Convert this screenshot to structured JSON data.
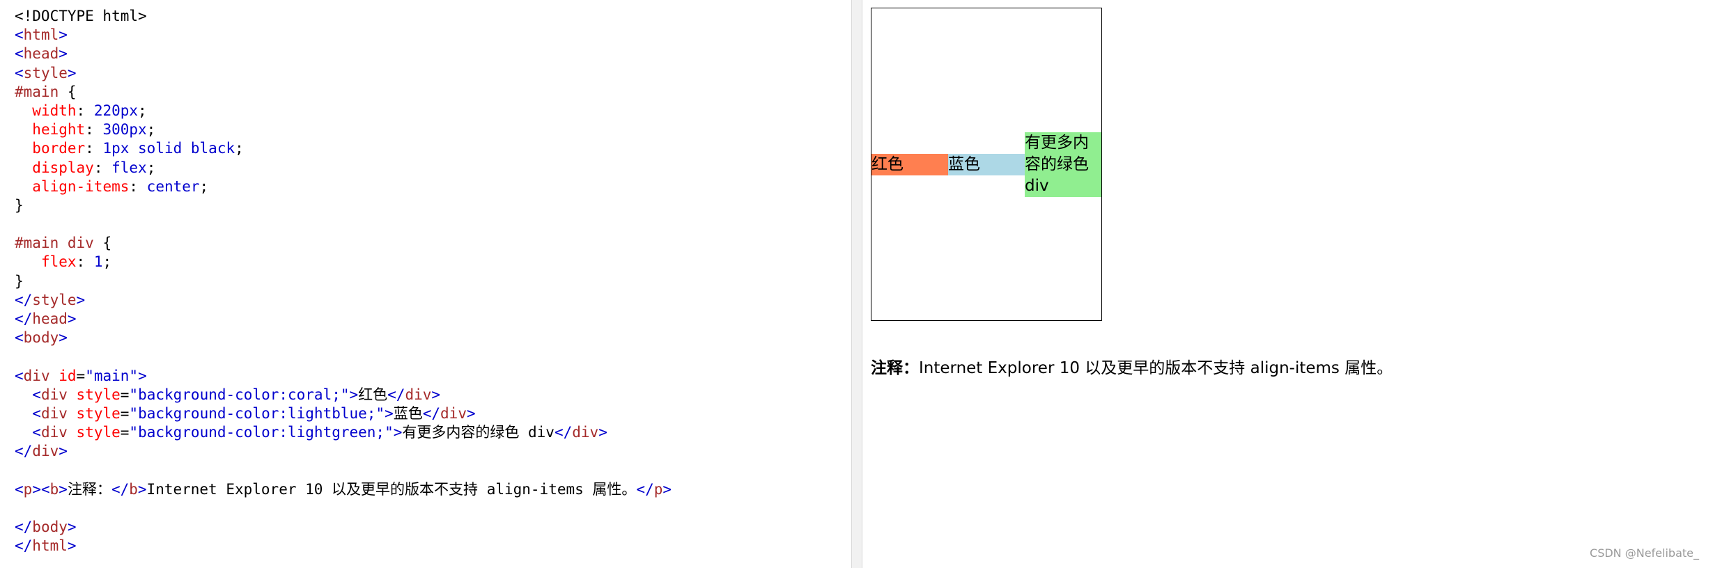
{
  "code_editor": {
    "lines": [
      [
        {
          "c": "plain",
          "t": "<!DOCTYPE html>"
        }
      ],
      [
        {
          "c": "tag",
          "t": "<"
        },
        {
          "c": "tn",
          "t": "html"
        },
        {
          "c": "tag",
          "t": ">"
        }
      ],
      [
        {
          "c": "tag",
          "t": "<"
        },
        {
          "c": "tn",
          "t": "head"
        },
        {
          "c": "tag",
          "t": ">"
        }
      ],
      [
        {
          "c": "tag",
          "t": "<"
        },
        {
          "c": "tn",
          "t": "style"
        },
        {
          "c": "tag",
          "t": ">"
        }
      ],
      [
        {
          "c": "sel",
          "t": "#main"
        },
        {
          "c": "plain",
          "t": " {"
        }
      ],
      [
        {
          "c": "plain",
          "t": "  "
        },
        {
          "c": "prop",
          "t": "width"
        },
        {
          "c": "plain",
          "t": ": "
        },
        {
          "c": "val",
          "t": "220px"
        },
        {
          "c": "plain",
          "t": ";"
        }
      ],
      [
        {
          "c": "plain",
          "t": "  "
        },
        {
          "c": "prop",
          "t": "height"
        },
        {
          "c": "plain",
          "t": ": "
        },
        {
          "c": "val",
          "t": "300px"
        },
        {
          "c": "plain",
          "t": ";"
        }
      ],
      [
        {
          "c": "plain",
          "t": "  "
        },
        {
          "c": "prop",
          "t": "border"
        },
        {
          "c": "plain",
          "t": ": "
        },
        {
          "c": "val",
          "t": "1px solid black"
        },
        {
          "c": "plain",
          "t": ";"
        }
      ],
      [
        {
          "c": "plain",
          "t": "  "
        },
        {
          "c": "prop",
          "t": "display"
        },
        {
          "c": "plain",
          "t": ": "
        },
        {
          "c": "val",
          "t": "flex"
        },
        {
          "c": "plain",
          "t": ";"
        }
      ],
      [
        {
          "c": "plain",
          "t": "  "
        },
        {
          "c": "prop",
          "t": "align-items"
        },
        {
          "c": "plain",
          "t": ": "
        },
        {
          "c": "val",
          "t": "center"
        },
        {
          "c": "plain",
          "t": ";"
        }
      ],
      [
        {
          "c": "plain",
          "t": "}"
        }
      ],
      [
        {
          "c": "plain",
          "t": ""
        }
      ],
      [
        {
          "c": "sel",
          "t": "#main div"
        },
        {
          "c": "plain",
          "t": " {"
        }
      ],
      [
        {
          "c": "plain",
          "t": "   "
        },
        {
          "c": "prop",
          "t": "flex"
        },
        {
          "c": "plain",
          "t": ": "
        },
        {
          "c": "val",
          "t": "1"
        },
        {
          "c": "plain",
          "t": ";"
        }
      ],
      [
        {
          "c": "plain",
          "t": "}"
        }
      ],
      [
        {
          "c": "tag",
          "t": "</"
        },
        {
          "c": "tn",
          "t": "style"
        },
        {
          "c": "tag",
          "t": ">"
        }
      ],
      [
        {
          "c": "tag",
          "t": "</"
        },
        {
          "c": "tn",
          "t": "head"
        },
        {
          "c": "tag",
          "t": ">"
        }
      ],
      [
        {
          "c": "tag",
          "t": "<"
        },
        {
          "c": "tn",
          "t": "body"
        },
        {
          "c": "tag",
          "t": ">"
        }
      ],
      [
        {
          "c": "plain",
          "t": ""
        }
      ],
      [
        {
          "c": "tag",
          "t": "<"
        },
        {
          "c": "tn",
          "t": "div"
        },
        {
          "c": "plain",
          "t": " "
        },
        {
          "c": "attr",
          "t": "id"
        },
        {
          "c": "plain",
          "t": "="
        },
        {
          "c": "aval",
          "t": "\"main\""
        },
        {
          "c": "tag",
          "t": ">"
        }
      ],
      [
        {
          "c": "plain",
          "t": "  "
        },
        {
          "c": "tag",
          "t": "<"
        },
        {
          "c": "tn",
          "t": "div"
        },
        {
          "c": "plain",
          "t": " "
        },
        {
          "c": "attr",
          "t": "style"
        },
        {
          "c": "plain",
          "t": "="
        },
        {
          "c": "aval",
          "t": "\"background-color:coral;\""
        },
        {
          "c": "tag",
          "t": ">"
        },
        {
          "c": "plain",
          "t": "红色"
        },
        {
          "c": "tag",
          "t": "</"
        },
        {
          "c": "tn",
          "t": "div"
        },
        {
          "c": "tag",
          "t": ">"
        }
      ],
      [
        {
          "c": "plain",
          "t": "  "
        },
        {
          "c": "tag",
          "t": "<"
        },
        {
          "c": "tn",
          "t": "div"
        },
        {
          "c": "plain",
          "t": " "
        },
        {
          "c": "attr",
          "t": "style"
        },
        {
          "c": "plain",
          "t": "="
        },
        {
          "c": "aval",
          "t": "\"background-color:lightblue;\""
        },
        {
          "c": "tag",
          "t": ">"
        },
        {
          "c": "plain",
          "t": "蓝色"
        },
        {
          "c": "tag",
          "t": "</"
        },
        {
          "c": "tn",
          "t": "div"
        },
        {
          "c": "tag",
          "t": ">"
        }
      ],
      [
        {
          "c": "plain",
          "t": "  "
        },
        {
          "c": "tag",
          "t": "<"
        },
        {
          "c": "tn",
          "t": "div"
        },
        {
          "c": "plain",
          "t": " "
        },
        {
          "c": "attr",
          "t": "style"
        },
        {
          "c": "plain",
          "t": "="
        },
        {
          "c": "aval",
          "t": "\"background-color:lightgreen;\""
        },
        {
          "c": "tag",
          "t": ">"
        },
        {
          "c": "plain",
          "t": "有更多内容的绿色 div"
        },
        {
          "c": "tag",
          "t": "</"
        },
        {
          "c": "tn",
          "t": "div"
        },
        {
          "c": "tag",
          "t": ">"
        }
      ],
      [
        {
          "c": "tag",
          "t": "</"
        },
        {
          "c": "tn",
          "t": "div"
        },
        {
          "c": "tag",
          "t": ">"
        }
      ],
      [
        {
          "c": "plain",
          "t": ""
        }
      ],
      [
        {
          "c": "tag",
          "t": "<"
        },
        {
          "c": "tn",
          "t": "p"
        },
        {
          "c": "tag",
          "t": ">"
        },
        {
          "c": "tag",
          "t": "<"
        },
        {
          "c": "tn",
          "t": "b"
        },
        {
          "c": "tag",
          "t": ">"
        },
        {
          "c": "plain",
          "t": "注释："
        },
        {
          "c": "tag",
          "t": "</"
        },
        {
          "c": "tn",
          "t": "b"
        },
        {
          "c": "tag",
          "t": ">"
        },
        {
          "c": "plain",
          "t": "Internet Explorer 10 以及更早的版本不支持 align-items 属性。"
        },
        {
          "c": "tag",
          "t": "</"
        },
        {
          "c": "tn",
          "t": "p"
        },
        {
          "c": "tag",
          "t": ">"
        }
      ],
      [
        {
          "c": "plain",
          "t": ""
        }
      ],
      [
        {
          "c": "tag",
          "t": "</"
        },
        {
          "c": "tn",
          "t": "body"
        },
        {
          "c": "tag",
          "t": ">"
        }
      ],
      [
        {
          "c": "tag",
          "t": "</"
        },
        {
          "c": "tn",
          "t": "html"
        },
        {
          "c": "tag",
          "t": ">"
        }
      ]
    ],
    "colors": {
      "tag": "#0000cd",
      "tag_name": "#a52a2a",
      "attribute": "#ff0000",
      "attribute_value": "#0000cd",
      "selector": "#a52a2a",
      "property": "#ff0000",
      "value": "#0000cd"
    }
  },
  "preview": {
    "items": [
      {
        "label": "红色",
        "color": "#ff7f50"
      },
      {
        "label": "蓝色",
        "color": "#add8e6"
      },
      {
        "label": "有更多内容的绿色 div",
        "color": "#90ee90"
      }
    ],
    "note_bold": "注释：",
    "note_text": "Internet Explorer 10 以及更早的版本不支持 align-items 属性。"
  },
  "watermark": "CSDN @Nefelibate_"
}
